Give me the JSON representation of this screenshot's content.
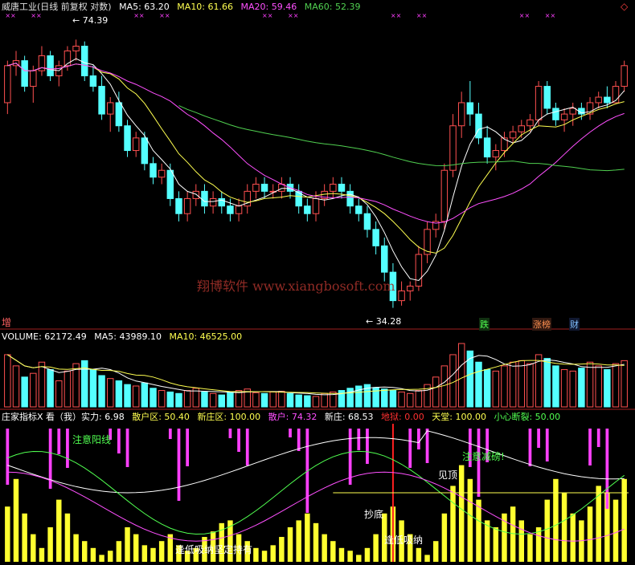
{
  "header": {
    "title": "威唐工业(日线 前复权 对数)",
    "ma5": "MA5: 63.20",
    "ma10": "MA10: 61.66",
    "ma20": "MA20: 59.46",
    "ma60": "MA60: 52.39",
    "label_zeng": "增"
  },
  "volume": {
    "value": "VOLUME: 62172.49",
    "ma5": "MA5: 43989.10",
    "ma10": "MA10: 46525.00"
  },
  "indicator": {
    "name": "庄家指标X 看（我）实力: 6.98",
    "sanhu_qu": "散户区: 50.40",
    "xinzhuang_qu": "新庄区: 100.00",
    "sanhu": "散户: 74.32",
    "xinzhuang": "新庄: 68.53",
    "diyu": "地狱: 0.00",
    "tiantang": "天堂: 100.00",
    "xiaoxin": "小心断裂: 50.00"
  },
  "signals": {
    "die": "跌",
    "bang": "涨榜",
    "cai": "财"
  },
  "annotations": {
    "high_price": "74.39",
    "low_price": "34.28",
    "top_warn": "注意阳线",
    "bottom_buy": "逢低吸纳坚定持有",
    "mid_buy": "逢低吸纳",
    "bull_top": "注意减磅!",
    "jian_ding": "见顶",
    "chao_di": "抄底"
  },
  "watermark": "翔博软件 www.xiangbosoft.com",
  "colors": {
    "up": "#ff5050",
    "down": "#54ffff",
    "ma5": "#ffffff",
    "ma10": "#ffff50",
    "ma20": "#ff50ff",
    "ma60": "#50d050",
    "magenta": "#ff40ff",
    "yellow": "#ffff30"
  },
  "chart_data": {
    "type": "candlestick",
    "y_scale": "log",
    "ylim": [
      33,
      80
    ],
    "price_labels": {
      "high": 74.39,
      "low": 34.28
    },
    "candles": [
      [
        62,
        70,
        60,
        69
      ],
      [
        69,
        72,
        67,
        70
      ],
      [
        70,
        71,
        64,
        65
      ],
      [
        65,
        69,
        62,
        68
      ],
      [
        68,
        73,
        67,
        71
      ],
      [
        71,
        72,
        66,
        67
      ],
      [
        67,
        70,
        65,
        69
      ],
      [
        69,
        73,
        68,
        72
      ],
      [
        72,
        74.39,
        70,
        73
      ],
      [
        73,
        74,
        66,
        67
      ],
      [
        67,
        69,
        64,
        65
      ],
      [
        65,
        67,
        59,
        60
      ],
      [
        60,
        63,
        57,
        62
      ],
      [
        62,
        64,
        57,
        58
      ],
      [
        58,
        59,
        53,
        54
      ],
      [
        54,
        57,
        53,
        56
      ],
      [
        56,
        57,
        51,
        52
      ],
      [
        52,
        53,
        49,
        50
      ],
      [
        50,
        52,
        49,
        51
      ],
      [
        51,
        52,
        46,
        47
      ],
      [
        47,
        48,
        44,
        45
      ],
      [
        45,
        48,
        44,
        47
      ],
      [
        47,
        49,
        46,
        48
      ],
      [
        48,
        49,
        45,
        46
      ],
      [
        46,
        48,
        45,
        47
      ],
      [
        47,
        48,
        45,
        46
      ],
      [
        46,
        47,
        44,
        45
      ],
      [
        45,
        47,
        44,
        46
      ],
      [
        46,
        49,
        45,
        48
      ],
      [
        48,
        50,
        47,
        49
      ],
      [
        49,
        50,
        47,
        48
      ],
      [
        48,
        49,
        47,
        48
      ],
      [
        48,
        50,
        47,
        49
      ],
      [
        49,
        50,
        47,
        48
      ],
      [
        48,
        49,
        45,
        46
      ],
      [
        46,
        47,
        44,
        45
      ],
      [
        45,
        48,
        44,
        47
      ],
      [
        47,
        49,
        46,
        48
      ],
      [
        48,
        50,
        47,
        49
      ],
      [
        49,
        50,
        47,
        48
      ],
      [
        48,
        49,
        45,
        46
      ],
      [
        46,
        47,
        44,
        45
      ],
      [
        45,
        46,
        42,
        43
      ],
      [
        43,
        44,
        40,
        41
      ],
      [
        41,
        42,
        37,
        38
      ],
      [
        38,
        39,
        34.28,
        35
      ],
      [
        35,
        37,
        34.5,
        36
      ],
      [
        36,
        37,
        35,
        36.5
      ],
      [
        36.5,
        41,
        36,
        40
      ],
      [
        40,
        44,
        39,
        43
      ],
      [
        43,
        45,
        42,
        44
      ],
      [
        44,
        52,
        43,
        51
      ],
      [
        51,
        60,
        50,
        58
      ],
      [
        58,
        64,
        56,
        62
      ],
      [
        62,
        66,
        58,
        60
      ],
      [
        60,
        62,
        55,
        56
      ],
      [
        56,
        58,
        52,
        53
      ],
      [
        53,
        55,
        51,
        54
      ],
      [
        54,
        57,
        53,
        56
      ],
      [
        56,
        58,
        55,
        57
      ],
      [
        57,
        59,
        56,
        58
      ],
      [
        58,
        60,
        57,
        59
      ],
      [
        59,
        66,
        58,
        65
      ],
      [
        65,
        66,
        60,
        61
      ],
      [
        61,
        62,
        58,
        59
      ],
      [
        59,
        61,
        57,
        60
      ],
      [
        60,
        62,
        58,
        61
      ],
      [
        61,
        62,
        59,
        60
      ],
      [
        60,
        63,
        59,
        62
      ],
      [
        62,
        64,
        61,
        63
      ],
      [
        63,
        65,
        61,
        62
      ],
      [
        62,
        66,
        62,
        65
      ],
      [
        65,
        70,
        64,
        69
      ]
    ],
    "ma_lines": {
      "MA5": 63.2,
      "MA10": 61.66,
      "MA20": 59.46,
      "MA60": 52.39
    },
    "volume": [
      70,
      55,
      40,
      45,
      60,
      50,
      35,
      48,
      58,
      62,
      50,
      42,
      38,
      35,
      30,
      28,
      32,
      25,
      22,
      20,
      18,
      22,
      25,
      20,
      18,
      16,
      20,
      22,
      24,
      19,
      18,
      20,
      21,
      18,
      16,
      15,
      14,
      18,
      20,
      22,
      25,
      28,
      30,
      26,
      24,
      22,
      20,
      18,
      22,
      30,
      40,
      55,
      70,
      85,
      75,
      60,
      50,
      48,
      55,
      60,
      62,
      58,
      70,
      65,
      55,
      50,
      48,
      52,
      60,
      55,
      50,
      58,
      62
    ],
    "volume_labels": {
      "VOLUME": 62172.49,
      "MA5": 43989.1,
      "MA10": 46525.0
    },
    "indicator_bars": [
      40,
      60,
      35,
      20,
      10,
      25,
      45,
      35,
      20,
      15,
      10,
      5,
      8,
      15,
      25,
      20,
      12,
      10,
      15,
      20,
      12,
      8,
      10,
      18,
      22,
      28,
      30,
      20,
      15,
      10,
      8,
      12,
      18,
      25,
      30,
      35,
      28,
      20,
      15,
      10,
      8,
      5,
      10,
      20,
      35,
      40,
      30,
      20,
      10,
      5,
      15,
      35,
      55,
      70,
      60,
      45,
      30,
      25,
      35,
      40,
      30,
      20,
      25,
      45,
      60,
      50,
      35,
      30,
      40,
      55,
      50,
      45,
      60
    ],
    "indicator_values": {
      "实力": 6.98,
      "散户区": 50.4,
      "新庄区": 100.0,
      "散户": 74.32,
      "新庄": 68.53,
      "地狱": 0.0,
      "天堂": 100.0,
      "小心断裂": 50.0
    }
  }
}
